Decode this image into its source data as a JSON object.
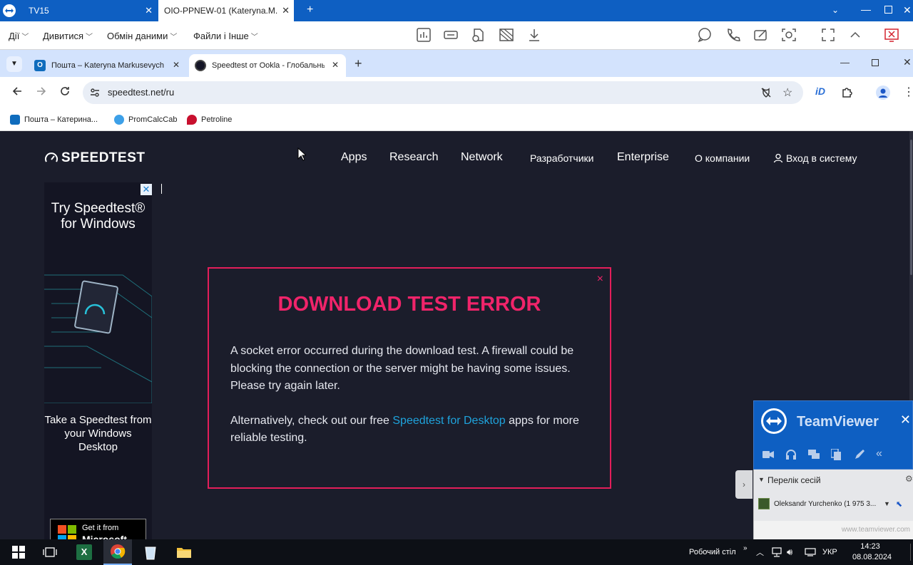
{
  "teamviewer": {
    "tabs": [
      {
        "label": "TV15"
      },
      {
        "label": "OIO-PPNEW-01 (Kateryna.M..."
      }
    ],
    "menus": [
      {
        "label": "Дії"
      },
      {
        "label": "Дивитися"
      },
      {
        "label": "Обмін даними"
      },
      {
        "label": "Файли і Інше"
      }
    ]
  },
  "chrome": {
    "tabs": [
      {
        "label": "Пошта – Kateryna Markusevych"
      },
      {
        "label": "Speedtest от Ookla - Глобальный"
      }
    ],
    "url": "speedtest.net/ru",
    "bookmarks": [
      {
        "label": "Пошта – Катерина..."
      },
      {
        "label": "PromCalcCab"
      },
      {
        "label": "Petroline"
      }
    ]
  },
  "speedtest": {
    "logo": "SPEEDTEST",
    "nav": {
      "apps": "Apps",
      "research": "Research",
      "network": "Network",
      "developers": "Разработчики",
      "enterprise": "Enterprise",
      "about": "О компании",
      "login": "Вход в систему"
    },
    "ad": {
      "title": "Try Speedtest® for Windows",
      "subtitle": "Take a Speedtest from your Windows Desktop",
      "badge_line1": "Get it from",
      "badge_line2": "Microsoft"
    },
    "modal": {
      "title": "DOWNLOAD TEST ERROR",
      "paragraph1": "A socket error occurred during the download test. A firewall could be blocking the connection or the server might be having some issues. Please try again later.",
      "paragraph2_before": "Alternatively, check out our free ",
      "paragraph2_link": "Speedtest for Desktop",
      "paragraph2_after": " apps for more reliable testing.",
      "close": "×"
    }
  },
  "teamviewer_panel": {
    "title": "TeamViewer",
    "session_list_label": "Перелік сесій",
    "session_user": "Oleksandr Yurchenko (1 975 3...",
    "footer": "www.teamviewer.com"
  },
  "taskbar": {
    "desktop_label": "Робочий стіл",
    "language": "УКР",
    "time": "14:23",
    "date": "08.08.2024"
  },
  "colors": {
    "teamviewer_blue": "#0e5fc2",
    "speedtest_bg": "#1b1d2b",
    "error_accent": "#e31e5a",
    "link": "#1fa3dc"
  }
}
